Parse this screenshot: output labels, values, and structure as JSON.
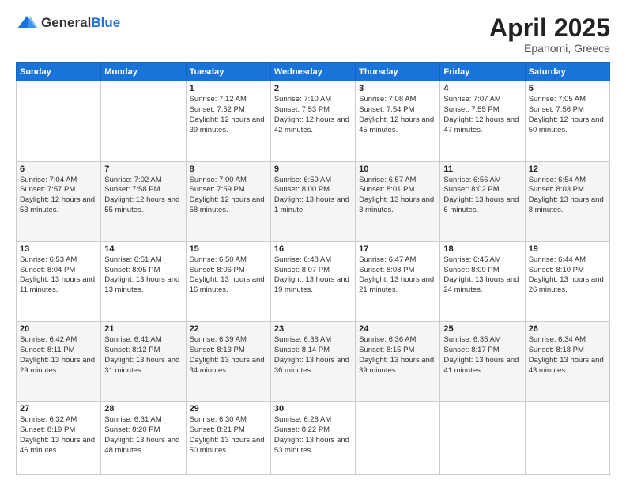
{
  "header": {
    "logo_general": "General",
    "logo_blue": "Blue",
    "title": "April 2025",
    "location": "Epanomi, Greece"
  },
  "calendar": {
    "days_of_week": [
      "Sunday",
      "Monday",
      "Tuesday",
      "Wednesday",
      "Thursday",
      "Friday",
      "Saturday"
    ],
    "weeks": [
      [
        {
          "day": "",
          "info": ""
        },
        {
          "day": "",
          "info": ""
        },
        {
          "day": "1",
          "info": "Sunrise: 7:12 AM\nSunset: 7:52 PM\nDaylight: 12 hours and 39 minutes."
        },
        {
          "day": "2",
          "info": "Sunrise: 7:10 AM\nSunset: 7:53 PM\nDaylight: 12 hours and 42 minutes."
        },
        {
          "day": "3",
          "info": "Sunrise: 7:08 AM\nSunset: 7:54 PM\nDaylight: 12 hours and 45 minutes."
        },
        {
          "day": "4",
          "info": "Sunrise: 7:07 AM\nSunset: 7:55 PM\nDaylight: 12 hours and 47 minutes."
        },
        {
          "day": "5",
          "info": "Sunrise: 7:05 AM\nSunset: 7:56 PM\nDaylight: 12 hours and 50 minutes."
        }
      ],
      [
        {
          "day": "6",
          "info": "Sunrise: 7:04 AM\nSunset: 7:57 PM\nDaylight: 12 hours and 53 minutes."
        },
        {
          "day": "7",
          "info": "Sunrise: 7:02 AM\nSunset: 7:58 PM\nDaylight: 12 hours and 55 minutes."
        },
        {
          "day": "8",
          "info": "Sunrise: 7:00 AM\nSunset: 7:59 PM\nDaylight: 12 hours and 58 minutes."
        },
        {
          "day": "9",
          "info": "Sunrise: 6:59 AM\nSunset: 8:00 PM\nDaylight: 13 hours and 1 minute."
        },
        {
          "day": "10",
          "info": "Sunrise: 6:57 AM\nSunset: 8:01 PM\nDaylight: 13 hours and 3 minutes."
        },
        {
          "day": "11",
          "info": "Sunrise: 6:56 AM\nSunset: 8:02 PM\nDaylight: 13 hours and 6 minutes."
        },
        {
          "day": "12",
          "info": "Sunrise: 6:54 AM\nSunset: 8:03 PM\nDaylight: 13 hours and 8 minutes."
        }
      ],
      [
        {
          "day": "13",
          "info": "Sunrise: 6:53 AM\nSunset: 8:04 PM\nDaylight: 13 hours and 11 minutes."
        },
        {
          "day": "14",
          "info": "Sunrise: 6:51 AM\nSunset: 8:05 PM\nDaylight: 13 hours and 13 minutes."
        },
        {
          "day": "15",
          "info": "Sunrise: 6:50 AM\nSunset: 8:06 PM\nDaylight: 13 hours and 16 minutes."
        },
        {
          "day": "16",
          "info": "Sunrise: 6:48 AM\nSunset: 8:07 PM\nDaylight: 13 hours and 19 minutes."
        },
        {
          "day": "17",
          "info": "Sunrise: 6:47 AM\nSunset: 8:08 PM\nDaylight: 13 hours and 21 minutes."
        },
        {
          "day": "18",
          "info": "Sunrise: 6:45 AM\nSunset: 8:09 PM\nDaylight: 13 hours and 24 minutes."
        },
        {
          "day": "19",
          "info": "Sunrise: 6:44 AM\nSunset: 8:10 PM\nDaylight: 13 hours and 26 minutes."
        }
      ],
      [
        {
          "day": "20",
          "info": "Sunrise: 6:42 AM\nSunset: 8:11 PM\nDaylight: 13 hours and 29 minutes."
        },
        {
          "day": "21",
          "info": "Sunrise: 6:41 AM\nSunset: 8:12 PM\nDaylight: 13 hours and 31 minutes."
        },
        {
          "day": "22",
          "info": "Sunrise: 6:39 AM\nSunset: 8:13 PM\nDaylight: 13 hours and 34 minutes."
        },
        {
          "day": "23",
          "info": "Sunrise: 6:38 AM\nSunset: 8:14 PM\nDaylight: 13 hours and 36 minutes."
        },
        {
          "day": "24",
          "info": "Sunrise: 6:36 AM\nSunset: 8:15 PM\nDaylight: 13 hours and 39 minutes."
        },
        {
          "day": "25",
          "info": "Sunrise: 6:35 AM\nSunset: 8:17 PM\nDaylight: 13 hours and 41 minutes."
        },
        {
          "day": "26",
          "info": "Sunrise: 6:34 AM\nSunset: 8:18 PM\nDaylight: 13 hours and 43 minutes."
        }
      ],
      [
        {
          "day": "27",
          "info": "Sunrise: 6:32 AM\nSunset: 8:19 PM\nDaylight: 13 hours and 46 minutes."
        },
        {
          "day": "28",
          "info": "Sunrise: 6:31 AM\nSunset: 8:20 PM\nDaylight: 13 hours and 48 minutes."
        },
        {
          "day": "29",
          "info": "Sunrise: 6:30 AM\nSunset: 8:21 PM\nDaylight: 13 hours and 50 minutes."
        },
        {
          "day": "30",
          "info": "Sunrise: 6:28 AM\nSunset: 8:22 PM\nDaylight: 13 hours and 53 minutes."
        },
        {
          "day": "",
          "info": ""
        },
        {
          "day": "",
          "info": ""
        },
        {
          "day": "",
          "info": ""
        }
      ]
    ]
  }
}
